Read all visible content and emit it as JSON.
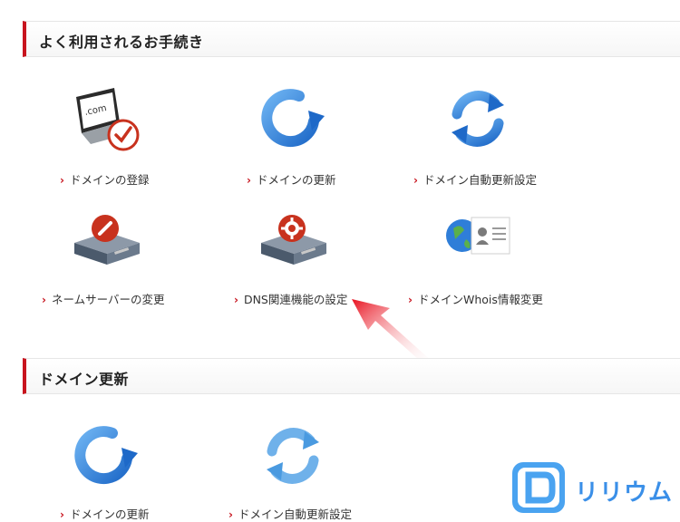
{
  "sections": [
    {
      "title": "よく利用されるお手続き",
      "items": [
        {
          "label": "ドメインの登録",
          "icon": "laptop-dotcom-check-icon",
          "icon_text": ".com"
        },
        {
          "label": "ドメインの更新",
          "icon": "renew-arrow-icon"
        },
        {
          "label": "ドメイン自動更新設定",
          "icon": "auto-renew-cycle-icon"
        },
        {
          "label": "ネームサーバーの変更",
          "icon": "server-pencil-icon"
        },
        {
          "label": "DNS関連機能の設定",
          "icon": "server-gear-icon"
        },
        {
          "label": "ドメインWhois情報変更",
          "icon": "globe-idcard-icon"
        }
      ]
    },
    {
      "title": "ドメイン更新",
      "items": [
        {
          "label": "ドメインの更新",
          "icon": "renew-arrow-icon"
        },
        {
          "label": "ドメイン自動更新設定",
          "icon": "auto-renew-cycle-icon"
        }
      ]
    }
  ],
  "watermark": {
    "text": "リリウム"
  },
  "colors": {
    "accent": "#c8141e",
    "blue": "#2f7ed8",
    "server": "#5a6b80"
  }
}
